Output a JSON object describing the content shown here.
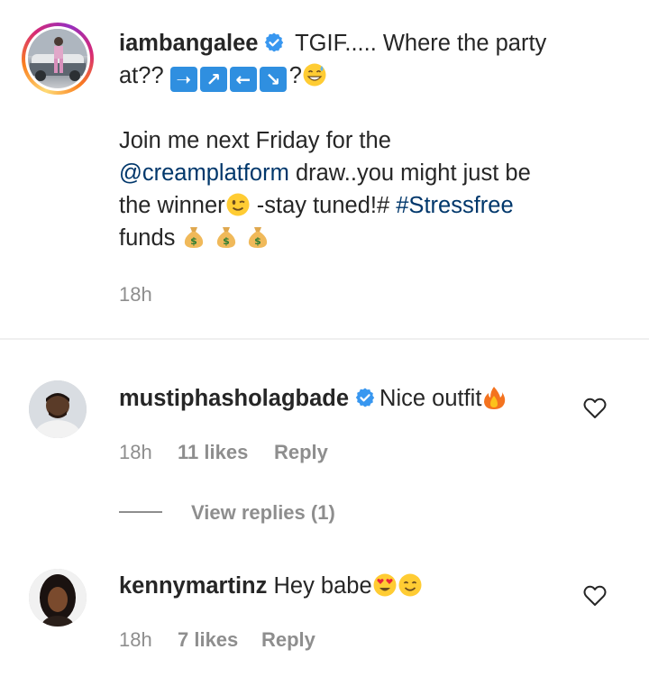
{
  "post": {
    "username": "iambangalee",
    "caption_line1": "TGIF..... Where the party",
    "caption_at": "at??",
    "arrows": [
      "➝",
      "↗",
      "←",
      "↘"
    ],
    "caption_q": "?",
    "caption_join": "Join me next Friday for the",
    "mention": "@creamplatform",
    "caption_draw": " draw..you might just be",
    "caption_winner": "the winner",
    "caption_stay": " -stay tuned!# ",
    "hashtag": "#Stressfree",
    "caption_funds": "funds",
    "time": "18h"
  },
  "comments": [
    {
      "username": "mustiphasholagbade",
      "text": "Nice outfit",
      "time": "18h",
      "likes": "11 likes",
      "reply": "Reply",
      "view_replies": "View replies (1)"
    },
    {
      "username": "kennymartinz",
      "text": "Hey babe",
      "time": "18h",
      "likes": "7 likes",
      "reply": "Reply"
    }
  ],
  "colors": {
    "link": "#00376b",
    "verified": "#3897f0",
    "muted": "#8e8e8e",
    "text": "#262626"
  },
  "icons": [
    "verified-badge-icon",
    "heart-outline-icon",
    "money-bag-icon",
    "winking-face-icon",
    "fire-icon",
    "heart-eyes-icon",
    "smiling-face-icon",
    "sweat-smile-icon"
  ]
}
